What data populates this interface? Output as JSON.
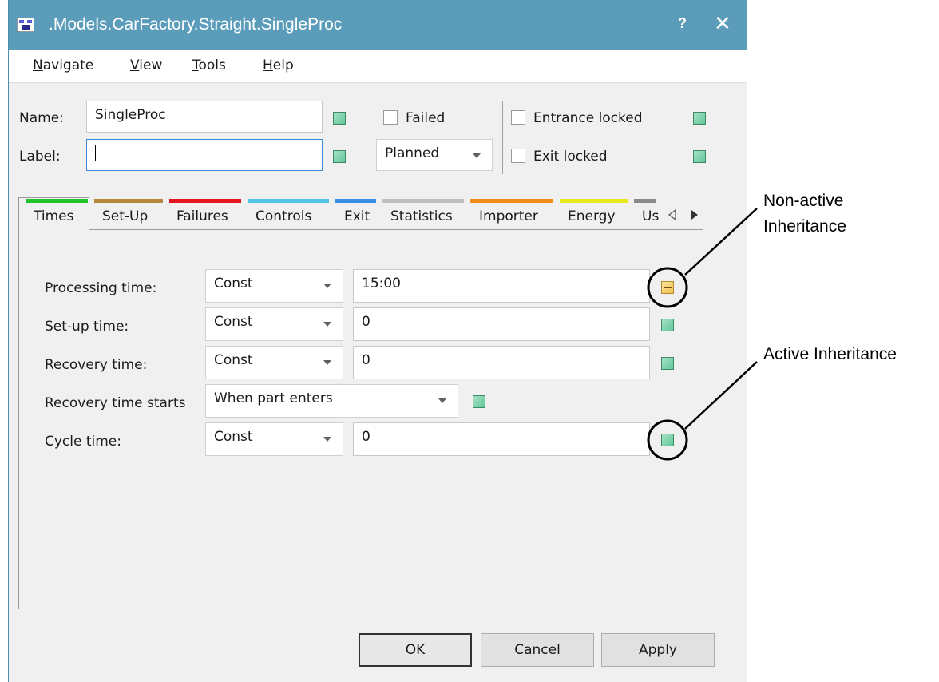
{
  "window": {
    "title": ".Models.CarFactory.Straight.SingleProc",
    "help": "?",
    "close": "✕"
  },
  "menu": [
    {
      "label": "Navigate",
      "accel": "N",
      "rest": "avigate"
    },
    {
      "label": "View",
      "accel": "V",
      "rest": "iew"
    },
    {
      "label": "Tools",
      "accel": "T",
      "rest": "ools"
    },
    {
      "label": "Help",
      "accel": "H",
      "rest": "elp"
    }
  ],
  "header": {
    "name_label": "Name:",
    "name_value": "SingleProc",
    "label_label": "Label:",
    "label_value": "",
    "failed_label": "Failed",
    "planned_value": "Planned",
    "entrance_locked_label": "Entrance locked",
    "exit_locked_label": "Exit locked"
  },
  "tabs": [
    {
      "label": "Times",
      "color": "#22c22b"
    },
    {
      "label": "Set-Up",
      "color": "#b5893a"
    },
    {
      "label": "Failures",
      "color": "#e5141e"
    },
    {
      "label": "Controls",
      "color": "#52c4ea"
    },
    {
      "label": "Exit",
      "color": "#3a8ee6"
    },
    {
      "label": "Statistics",
      "color": "#bfbfbf"
    },
    {
      "label": "Importer",
      "color": "#f08c1a"
    },
    {
      "label": "Energy",
      "color": "#e8e81a"
    },
    {
      "label": "Us",
      "color": "#8a8a8a"
    }
  ],
  "times": {
    "rows": [
      {
        "label": "Processing time:",
        "dist": "Const",
        "value": "15:00"
      },
      {
        "label": "Set-up time:",
        "dist": "Const",
        "value": "0"
      },
      {
        "label": "Recovery time:",
        "dist": "Const",
        "value": "0"
      },
      {
        "label": "Recovery time starts",
        "dist": "When part enters",
        "value": ""
      },
      {
        "label": "Cycle time:",
        "dist": "Const",
        "value": "0"
      }
    ]
  },
  "buttons": {
    "ok": "OK",
    "cancel": "Cancel",
    "apply": "Apply"
  },
  "callouts": {
    "nonactive_line1": "Non-active",
    "nonactive_line2": "Inheritance",
    "active": "Active Inheritance"
  },
  "colors": {
    "titlebar": "#5a9cb9",
    "inherit_active": "#62c79a",
    "inherit_nonactive": "#f2c14e"
  }
}
